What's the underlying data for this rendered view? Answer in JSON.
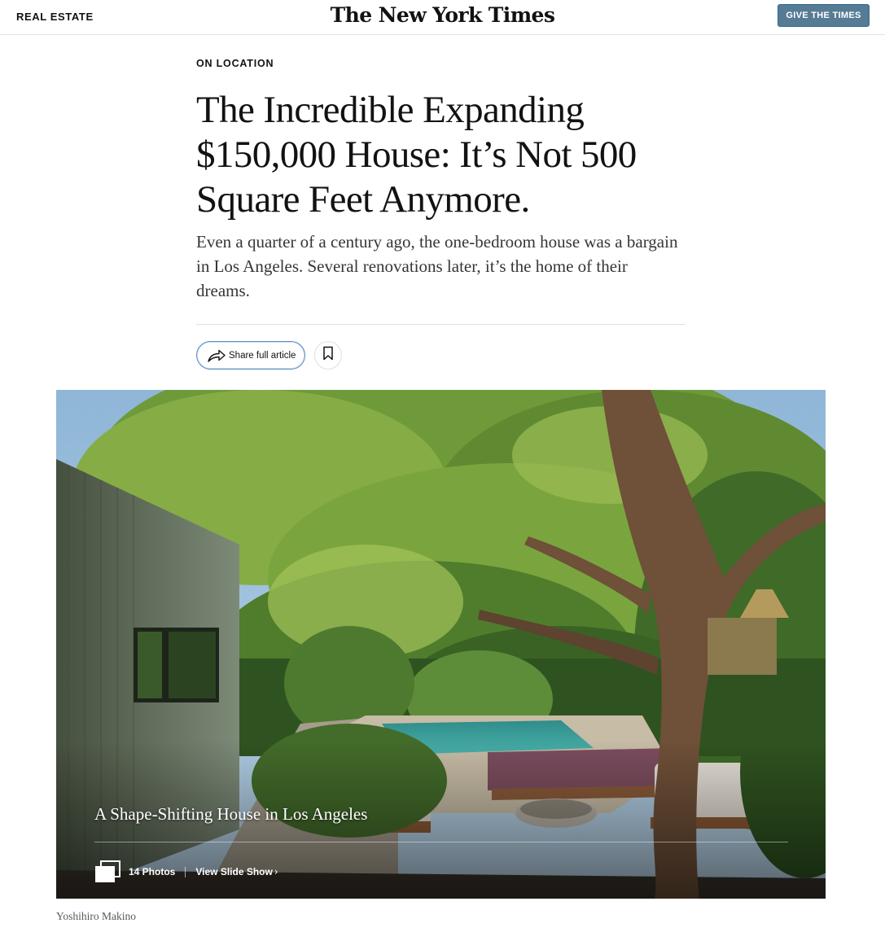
{
  "header": {
    "section": "REAL ESTATE",
    "masthead": "The New York Times",
    "give_button": "GIVE THE TIMES"
  },
  "article": {
    "kicker": "ON LOCATION",
    "headline": "The Incredible Expanding $150,000 House: It’s Not 500 Square Feet Anymore.",
    "summary": "Even a quarter of a century ago, the one-bedroom house was a bargain in Los Angeles. Several renovations later, it’s the home of their dreams.",
    "share_label": "Share full article"
  },
  "icons": {
    "share": "share-arrow-icon",
    "save": "bookmark-icon",
    "slideshow": "photo-stack-icon"
  },
  "media": {
    "slideshow_title": "A Shape-Shifting House in Los Angeles",
    "photo_count": "14 Photos",
    "view_label": "View Slide Show",
    "view_chevron": "›",
    "credit": "Yoshihiro Makino"
  },
  "colors": {
    "give_button_bg": "#567b95",
    "share_button_border": "#5a8cc4",
    "text": "#121212"
  }
}
